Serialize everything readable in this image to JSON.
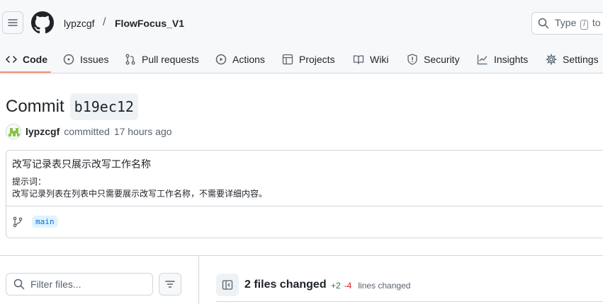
{
  "header": {
    "owner": "lypzcgf",
    "separator": "/",
    "repo": "FlowFocus_V1",
    "search_prefix": "Type",
    "search_key": "/",
    "search_suffix": "to"
  },
  "tabs": [
    {
      "label": "Code",
      "icon": "code-icon",
      "active": true
    },
    {
      "label": "Issues",
      "icon": "issue-icon"
    },
    {
      "label": "Pull requests",
      "icon": "pull-request-icon"
    },
    {
      "label": "Actions",
      "icon": "play-icon"
    },
    {
      "label": "Projects",
      "icon": "table-icon"
    },
    {
      "label": "Wiki",
      "icon": "book-icon"
    },
    {
      "label": "Security",
      "icon": "shield-icon"
    },
    {
      "label": "Insights",
      "icon": "graph-icon"
    },
    {
      "label": "Settings",
      "icon": "gear-icon"
    }
  ],
  "commit": {
    "title_word": "Commit",
    "sha": "b19ec12",
    "author": "lypzcgf",
    "action": "committed",
    "time": "17 hours ago",
    "message_title": "改写记录表只展示改写工作名称",
    "message_body_1": "提示词：",
    "message_body_2": "改写记录列表在列表中只需要展示改写工作名称，不需要详细内容。",
    "branch": "main"
  },
  "files": {
    "filter_placeholder": "Filter files...",
    "changed_label": "2 files changed",
    "additions": "+2",
    "deletions": "-4",
    "lines_label": "lines changed"
  },
  "colors": {
    "accent_underline": "#fd8c73",
    "additions": "#1a7f37",
    "deletions": "#d1242f",
    "link": "#0969da"
  }
}
